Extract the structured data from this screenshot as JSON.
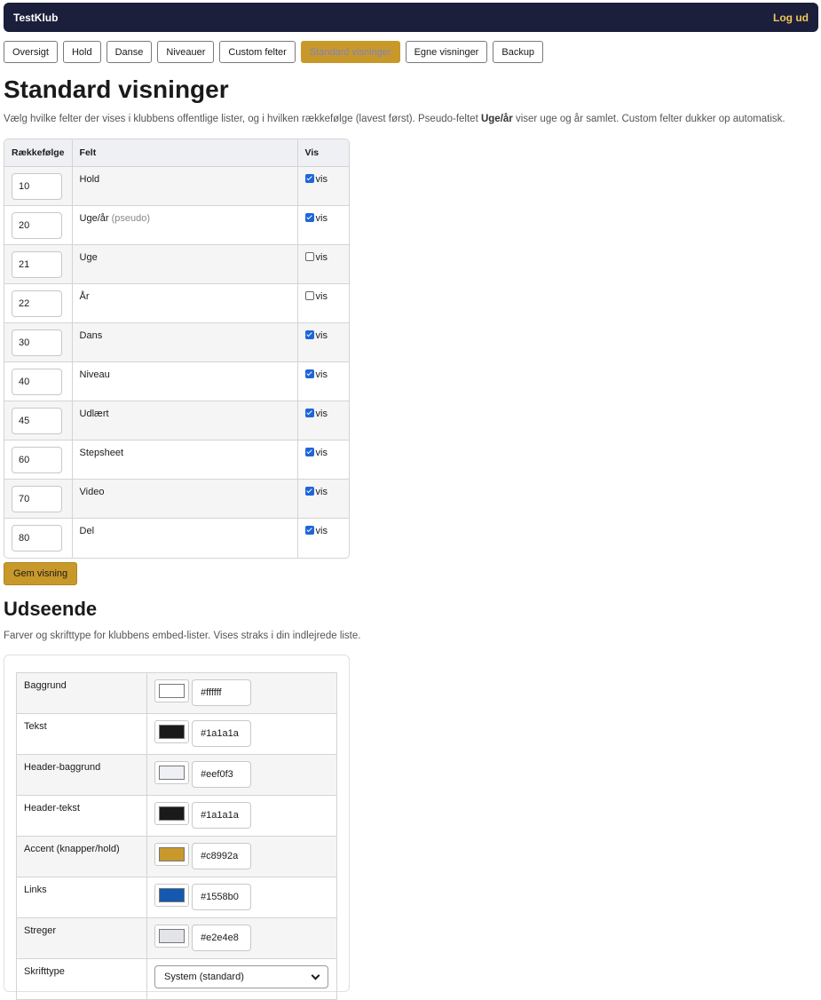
{
  "header": {
    "brand": "TestKlub",
    "logout_label": "Log ud"
  },
  "nav": {
    "items": [
      {
        "label": "Oversigt"
      },
      {
        "label": "Hold"
      },
      {
        "label": "Danse"
      },
      {
        "label": "Niveauer"
      },
      {
        "label": "Custom felter"
      },
      {
        "label": "Standard visninger",
        "active": true
      },
      {
        "label": "Egne visninger"
      },
      {
        "label": "Backup"
      }
    ]
  },
  "standard": {
    "title": "Standard visninger",
    "desc_before": "Vælg hvilke felter der vises i klubbens offentlige lister, og i hvilken rækkefølge (lavest først). Pseudo-feltet ",
    "desc_bold": "Uge/år",
    "desc_after": " viser uge og år samlet. Custom felter dukker op automatisk.",
    "columns": {
      "order": "Rækkefølge",
      "field": "Felt",
      "show": "Vis"
    },
    "show_label": "vis",
    "rows": [
      {
        "order": "10",
        "field": "Hold",
        "tag": "",
        "checked": true
      },
      {
        "order": "20",
        "field": "Uge/år",
        "tag": "(pseudo)",
        "checked": true
      },
      {
        "order": "21",
        "field": "Uge",
        "tag": "",
        "checked": false
      },
      {
        "order": "22",
        "field": "År",
        "tag": "",
        "checked": false
      },
      {
        "order": "30",
        "field": "Dans",
        "tag": "",
        "checked": true
      },
      {
        "order": "40",
        "field": "Niveau",
        "tag": "",
        "checked": true
      },
      {
        "order": "45",
        "field": "Udlært",
        "tag": "",
        "checked": true
      },
      {
        "order": "60",
        "field": "Stepsheet",
        "tag": "",
        "checked": true
      },
      {
        "order": "70",
        "field": "Video",
        "tag": "",
        "checked": true
      },
      {
        "order": "80",
        "field": "Del",
        "tag": "",
        "checked": true
      }
    ],
    "save_label": "Gem visning"
  },
  "appearance": {
    "title": "Udseende",
    "desc": "Farver og skrifttype for klubbens embed-lister. Vises straks i din indlejrede liste.",
    "rows": [
      {
        "label": "Baggrund",
        "value": "#ffffff"
      },
      {
        "label": "Tekst",
        "value": "#1a1a1a"
      },
      {
        "label": "Header-baggrund",
        "value": "#eef0f3"
      },
      {
        "label": "Header-tekst",
        "value": "#1a1a1a"
      },
      {
        "label": "Accent (knapper/hold)",
        "value": "#c8992a"
      },
      {
        "label": "Links",
        "value": "#1558b0"
      },
      {
        "label": "Streger",
        "value": "#e2e4e8"
      }
    ],
    "font": {
      "label": "Skrifttype",
      "value": "System (standard)"
    }
  }
}
